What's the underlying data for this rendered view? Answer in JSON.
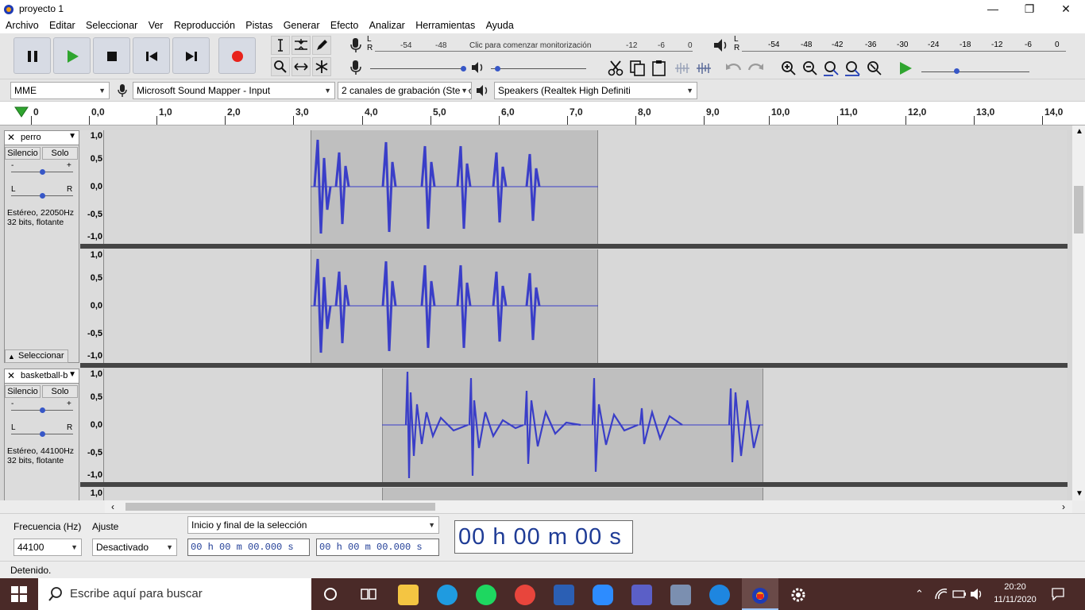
{
  "window": {
    "title": "proyecto 1"
  },
  "menu": [
    "Archivo",
    "Editar",
    "Seleccionar",
    "Ver",
    "Reproducción",
    "Pistas",
    "Generar",
    "Efecto",
    "Analizar",
    "Herramientas",
    "Ayuda"
  ],
  "meters": {
    "record_scale_left": [
      "-54",
      "-48"
    ],
    "record_prompt": "Clic para comenzar monitorización",
    "record_scale_right": [
      "-12",
      "-6",
      "0"
    ],
    "play_scale": [
      "-54",
      "-48",
      "-42",
      "-36",
      "-30",
      "-24",
      "-18",
      "-12",
      "-6",
      "0"
    ],
    "lr": [
      "L",
      "R"
    ]
  },
  "devices": {
    "host": "MME",
    "input": "Microsoft Sound Mapper - Input",
    "channels": "2 canales de grabación (Stereo)",
    "output": "Speakers (Realtek High Definiti"
  },
  "ruler": [
    "0",
    "0,0",
    "1,0",
    "2,0",
    "3,0",
    "4,0",
    "5,0",
    "6,0",
    "7,0",
    "8,0",
    "9,0",
    "10,0",
    "11,0",
    "12,0",
    "13,0",
    "14,0"
  ],
  "tracks": [
    {
      "name": "perro",
      "mute": "Silencio",
      "solo": "Solo",
      "gain_minus": "-",
      "gain_plus": "+",
      "pan_l": "L",
      "pan_r": "R",
      "info": "Estéreo, 22050Hz\n32 bits, flotante",
      "select": "Seleccionar",
      "scale": [
        "1,0",
        "0,5",
        "0,0",
        "-0,5",
        "-1,0"
      ]
    },
    {
      "name": "basketball-b",
      "mute": "Silencio",
      "solo": "Solo",
      "gain_minus": "-",
      "gain_plus": "+",
      "pan_l": "L",
      "pan_r": "R",
      "info": "Estéreo, 44100Hz\n32 bits, flotante",
      "scale": [
        "1,0",
        "0,5",
        "0,0",
        "-0,5",
        "-1,0"
      ],
      "scale2_top": "1,0"
    }
  ],
  "selection": {
    "rate_label": "Frecuencia (Hz)",
    "rate_value": "44100",
    "snap_label": "Ajuste",
    "snap_value": "Desactivado",
    "mode": "Inicio y final de la selección",
    "start": "00 h 00 m 00.000 s",
    "end": "00 h 00 m 00.000 s",
    "big_time": "00 h 00 m 00 s"
  },
  "status": "Detenido.",
  "taskbar": {
    "search_placeholder": "Escribe aquí para buscar",
    "time": "20:20",
    "date": "11/11/2020"
  },
  "colors": {
    "waveform": "#3a3ec8",
    "clip_bg": "#bfbfbf",
    "taskbar": "#4a2a28",
    "record": "#e8231c",
    "play": "#2fa52f"
  }
}
